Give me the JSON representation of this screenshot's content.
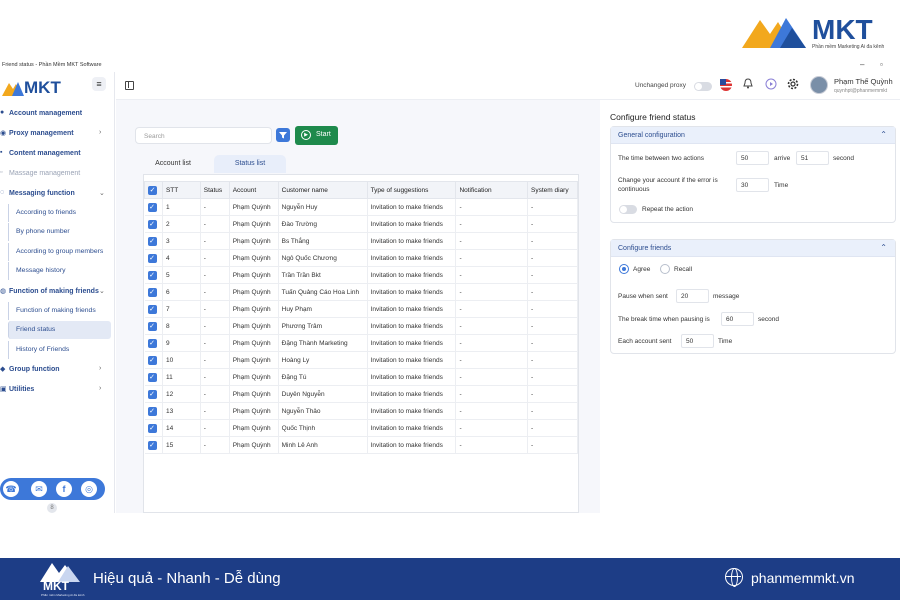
{
  "brand": {
    "name": "MKT",
    "tagline": "Phần mềm Marketing Ai đa kênh"
  },
  "window": {
    "title": "Friend status - Phần Mềm MKT Software",
    "minimize": "–",
    "maximize": "▫"
  },
  "sidebar": {
    "logo": "MKT",
    "menu_icon": "≡",
    "items": [
      {
        "label": "Account management",
        "chev": ""
      },
      {
        "label": "Proxy management",
        "chev": "›"
      },
      {
        "label": "Content management",
        "chev": ""
      },
      {
        "label": "Massage management",
        "chev": ""
      },
      {
        "label": "Messaging function",
        "chev": "⌄"
      },
      {
        "label": "Function of making friends",
        "chev": "⌄"
      },
      {
        "label": "Group function",
        "chev": "›"
      },
      {
        "label": "Utilities",
        "chev": "›"
      }
    ],
    "messaging_sub": [
      "According to friends",
      "By phone number",
      "According to group members",
      "Message history"
    ],
    "friends_sub": [
      "Function of making friends",
      "Friend status",
      "History of Friends"
    ],
    "scroll_label": "8"
  },
  "topbar": {
    "proxy_label": "Unchanged proxy",
    "user_name": "Phạm Thế Quỳnh",
    "user_email": "quynhpt@phanmemmkt"
  },
  "main": {
    "search_placeholder": "Search",
    "start_label": "Start",
    "tabs": [
      "Account list",
      "Status list"
    ],
    "columns": [
      "STT",
      "Status",
      "Account",
      "Customer name",
      "Type of suggestions",
      "Notification",
      "System diary"
    ],
    "rows": [
      [
        "1",
        "-",
        "Phạm Quỳnh",
        "Nguyễn Huy",
        "Invitation to make friends",
        "-",
        "-"
      ],
      [
        "2",
        "-",
        "Phạm Quỳnh",
        "Đào Trường",
        "Invitation to make friends",
        "-",
        "-"
      ],
      [
        "3",
        "-",
        "Phạm Quỳnh",
        "Bs Thắng",
        "Invitation to make friends",
        "-",
        "-"
      ],
      [
        "4",
        "-",
        "Phạm Quỳnh",
        "Ngô Quốc Chương",
        "Invitation to make friends",
        "-",
        "-"
      ],
      [
        "5",
        "-",
        "Phạm Quỳnh",
        "Trần Trần Bkt",
        "Invitation to make friends",
        "-",
        "-"
      ],
      [
        "6",
        "-",
        "Phạm Quỳnh",
        "Tuấn Quảng Cáo Hoa Linh",
        "Invitation to make friends",
        "-",
        "-"
      ],
      [
        "7",
        "-",
        "Phạm Quỳnh",
        "Huy Phạm",
        "Invitation to make friends",
        "-",
        "-"
      ],
      [
        "8",
        "-",
        "Phạm Quỳnh",
        "Phương Trâm",
        "Invitation to make friends",
        "-",
        "-"
      ],
      [
        "9",
        "-",
        "Phạm Quỳnh",
        "Đặng Thành Marketing",
        "Invitation to make friends",
        "-",
        "-"
      ],
      [
        "10",
        "-",
        "Phạm Quỳnh",
        "Hoàng Ly",
        "Invitation to make friends",
        "-",
        "-"
      ],
      [
        "11",
        "-",
        "Phạm Quỳnh",
        "Đặng Tú",
        "Invitation to make friends",
        "-",
        "-"
      ],
      [
        "12",
        "-",
        "Phạm Quỳnh",
        "Duyên Nguyễn",
        "Invitation to make friends",
        "-",
        "-"
      ],
      [
        "13",
        "-",
        "Phạm Quỳnh",
        "Nguyễn Thảo",
        "Invitation to make friends",
        "-",
        "-"
      ],
      [
        "14",
        "-",
        "Phạm Quỳnh",
        "Quốc Thịnh",
        "Invitation to make friends",
        "-",
        "-"
      ],
      [
        "15",
        "-",
        "Phạm Quỳnh",
        "Minh Lê Anh",
        "Invitation to make friends",
        "-",
        "-"
      ]
    ]
  },
  "config": {
    "title": "Configure friend status",
    "general": {
      "heading": "General configuration",
      "time_between_label": "The time between two actions",
      "time_from": "50",
      "arrive_label": "arrive",
      "time_to": "51",
      "second_label": "second",
      "change_account_label_1": "Change your account if the error is",
      "change_account_label_2": "continuous",
      "change_account_value": "30",
      "time_label": "Time",
      "repeat_label": "Repeat the action"
    },
    "friends": {
      "heading": "Configure friends",
      "agree_label": "Agree",
      "recall_label": "Recall",
      "pause_label": "Pause when sent",
      "pause_value": "20",
      "message_label": "message",
      "break_label": "The break time when pausing is",
      "break_value": "60",
      "break_unit": "second",
      "each_label": "Each account sent",
      "each_value": "50",
      "each_unit": "Time"
    }
  },
  "banner": {
    "slogan": "Hiệu quả - Nhanh - Dễ dùng",
    "site": "phanmemmkt.vn",
    "logo": "MKT",
    "logo_tag": "Phần mềm Marketing Ai đa kênh"
  },
  "colors": {
    "primary": "#3d78d9",
    "navy": "#1d3d86",
    "green": "#1e8a4c",
    "brand_orange": "#f2a81d"
  }
}
